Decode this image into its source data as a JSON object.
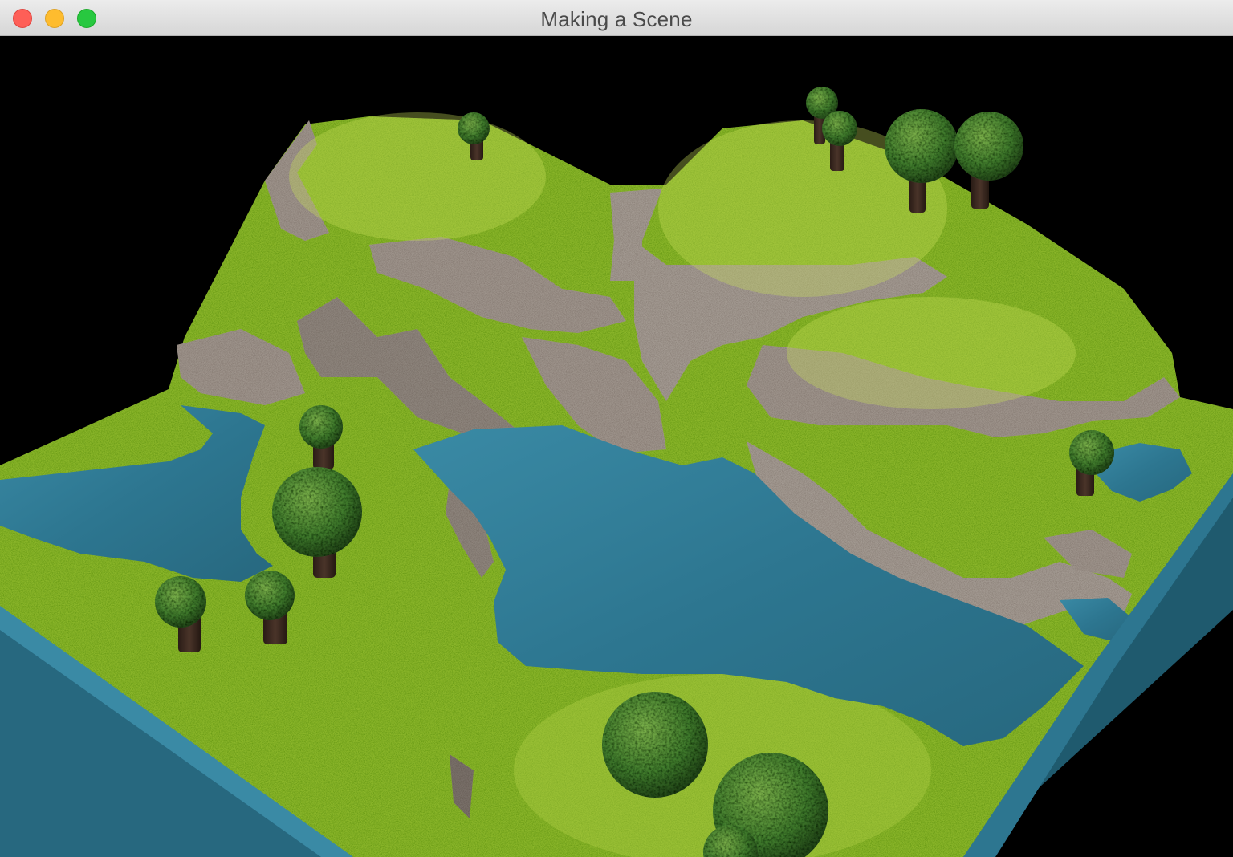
{
  "window": {
    "title": "Making a Scene",
    "controls": {
      "close_icon": "close-icon",
      "minimize_icon": "minimize-icon",
      "zoom_icon": "zoom-icon"
    }
  },
  "scene": {
    "background_color": "#000000",
    "colors": {
      "grass": "#8bb62a",
      "grass_dark": "#5f8a1c",
      "rock": "#9e948c",
      "rock_dark": "#7a716a",
      "water": "#2d7690",
      "water_light": "#3a8aa5",
      "tree_canopy": "#3f7a2c",
      "tree_canopy_light": "#7bb04a",
      "tree_trunk": "#3e2a22"
    }
  }
}
